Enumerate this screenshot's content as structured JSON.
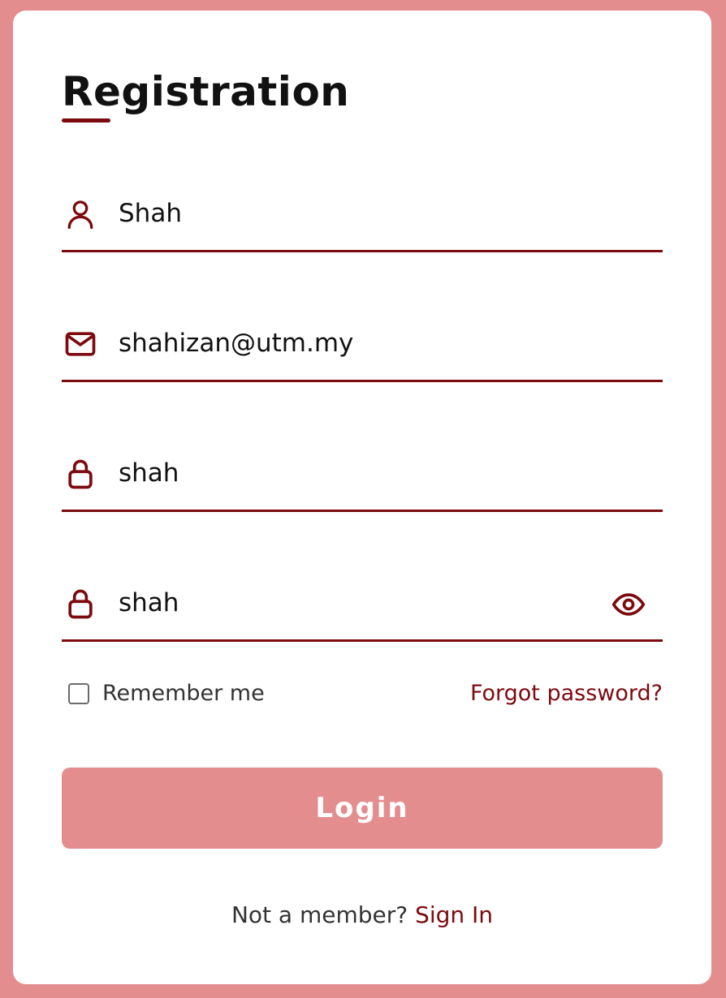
{
  "form": {
    "title": "Registration",
    "fields": [
      {
        "icon": "user-icon",
        "value": "Shah"
      },
      {
        "icon": "mail-icon",
        "value": "shahizan@utm.my"
      },
      {
        "icon": "lock-icon",
        "value": "shah"
      },
      {
        "icon": "lock-icon",
        "value": "shah",
        "trailing_icon": "eye-icon"
      }
    ],
    "remember_label": "Remember me",
    "remember_checked": false,
    "forgot_label": "Forgot password?",
    "submit_label": "Login",
    "footer_text": "Not a member?",
    "footer_link": "Sign In"
  },
  "colors": {
    "accent": "#7c0a0e",
    "background": "#e48d8f",
    "card": "#ffffff",
    "button": "#e48d8f"
  }
}
